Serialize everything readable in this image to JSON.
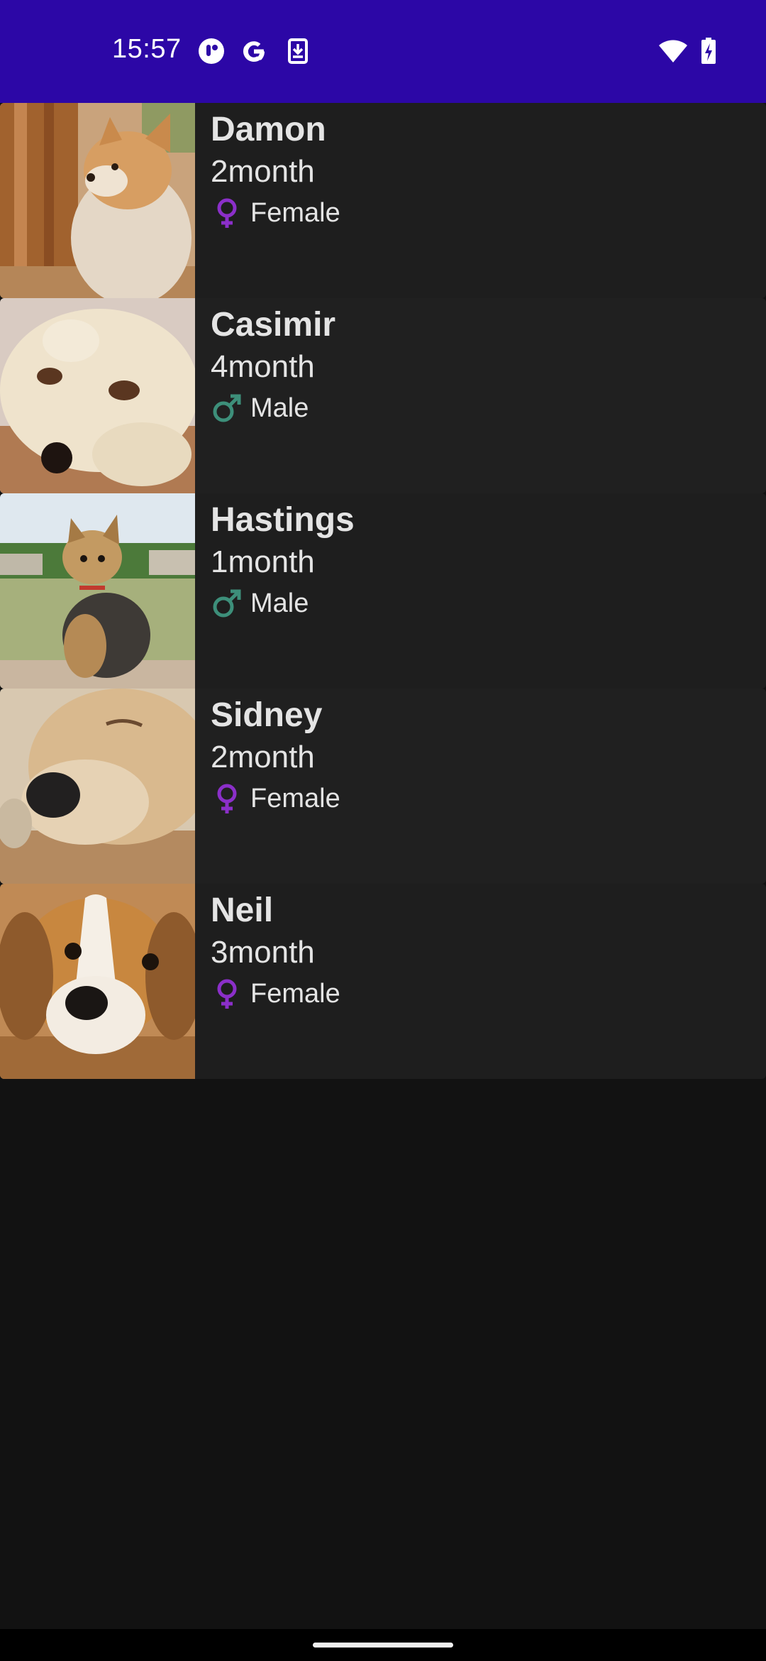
{
  "status_bar": {
    "time": "15:57",
    "icons": [
      "assistant-icon",
      "google-icon",
      "download-icon",
      "wifi-icon",
      "battery-charging-icon"
    ]
  },
  "colors": {
    "status_bar": "#2c07a6",
    "background": "#121212",
    "card": "#1f1f1f",
    "female": "#8b2fc9",
    "male": "#3d8f7a"
  },
  "puppies": [
    {
      "name": "Damon",
      "age": "2month",
      "gender": "Female",
      "gender_icon": "female-icon"
    },
    {
      "name": "Casimir",
      "age": "4month",
      "gender": "Male",
      "gender_icon": "male-icon"
    },
    {
      "name": "Hastings",
      "age": "1month",
      "gender": "Male",
      "gender_icon": "male-icon"
    },
    {
      "name": "Sidney",
      "age": "2month",
      "gender": "Female",
      "gender_icon": "female-icon"
    },
    {
      "name": "Neil",
      "age": "3month",
      "gender": "Female",
      "gender_icon": "female-icon"
    }
  ]
}
